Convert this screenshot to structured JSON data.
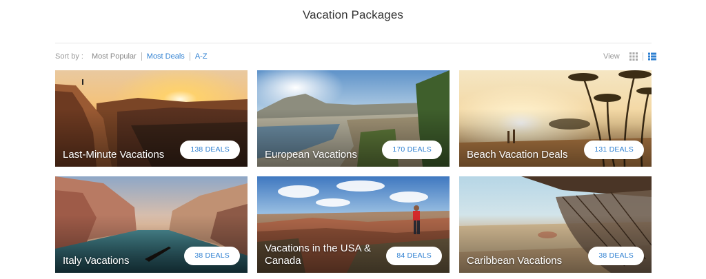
{
  "page": {
    "title": "Vacation Packages"
  },
  "sort": {
    "label": "Sort by :",
    "options": [
      {
        "label": "Most Popular",
        "active": false
      },
      {
        "label": "Most Deals",
        "active": true
      },
      {
        "label": "A-Z",
        "active": true
      }
    ]
  },
  "view": {
    "label": "View",
    "modes": [
      "grid-icon",
      "list-icon"
    ],
    "active": "list-icon"
  },
  "colors": {
    "accent": "#2d7fd1",
    "muted": "#999999",
    "title": "#333333"
  },
  "cards": [
    {
      "title": "Last-Minute Vacations",
      "deals": "138 DEALS",
      "scene": "canyon-sunset"
    },
    {
      "title": "European Vacations",
      "deals": "170 DEALS",
      "scene": "salzburg-river"
    },
    {
      "title": "Beach Vacation Deals",
      "deals": "131 DEALS",
      "scene": "palm-beach"
    },
    {
      "title": "Italy Vacations",
      "deals": "38 DEALS",
      "scene": "venice-canal"
    },
    {
      "title": "Vacations in the USA & Canada",
      "deals": "84 DEALS",
      "scene": "grand-canyon"
    },
    {
      "title": "Caribbean Vacations",
      "deals": "38 DEALS",
      "scene": "hammock-beach"
    }
  ]
}
